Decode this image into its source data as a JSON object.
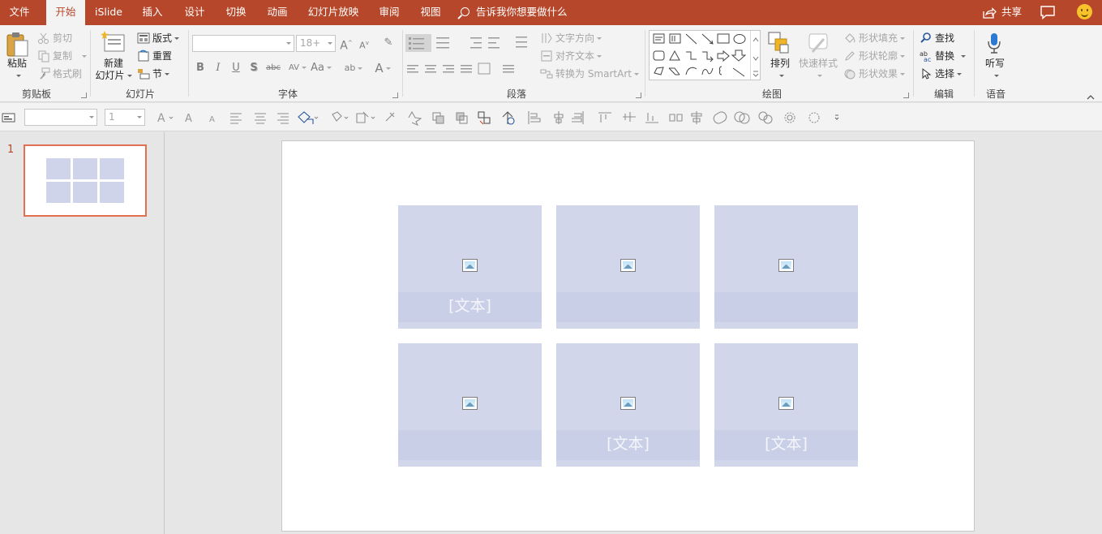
{
  "tabs": [
    {
      "label": "文件",
      "active": false
    },
    {
      "label": "开始",
      "active": true
    },
    {
      "label": "iSlide",
      "active": false
    },
    {
      "label": "插入",
      "active": false
    },
    {
      "label": "设计",
      "active": false
    },
    {
      "label": "切换",
      "active": false
    },
    {
      "label": "动画",
      "active": false
    },
    {
      "label": "幻灯片放映",
      "active": false
    },
    {
      "label": "审阅",
      "active": false
    },
    {
      "label": "视图",
      "active": false
    }
  ],
  "tell_me": "告诉我你想要做什么",
  "share_label": "共享",
  "colors": {
    "accent": "#b7472a",
    "ribbon_bg": "#f3f3f3",
    "placeholder": "#d1d6ea"
  },
  "clipboard": {
    "paste": "粘贴",
    "cut": "剪切",
    "copy": "复制",
    "format_painter": "格式刷",
    "group": "剪贴板"
  },
  "slides_group": {
    "new_slide_line1": "新建",
    "new_slide_line2": "幻灯片",
    "layout": "版式",
    "reset": "重置",
    "section": "节",
    "group": "幻灯片"
  },
  "font_group": {
    "font_name": "",
    "font_size": "18+",
    "bold": "B",
    "italic": "I",
    "underline": "U",
    "shadow": "S",
    "strike": "abc",
    "spacing": "AV",
    "case": "Aa",
    "group": "字体"
  },
  "paragraph": {
    "text_direction": "文字方向",
    "align_text": "对齐文本",
    "smartart": "转换为 SmartArt",
    "group": "段落"
  },
  "drawing": {
    "arrange": "排列",
    "quick_styles": "快速样式",
    "shape_fill": "形状填充",
    "shape_outline": "形状轮廓",
    "shape_effects": "形状效果",
    "group": "绘图"
  },
  "editing": {
    "find": "查找",
    "replace": "替换",
    "select": "选择",
    "group": "编辑"
  },
  "voice": {
    "dictate": "听写",
    "group": "语音"
  },
  "qbar": {
    "size_value": "1"
  },
  "thumbnail": {
    "number": "1"
  },
  "slide": {
    "placeholders": [
      {
        "text": "[文本]"
      },
      {
        "text": ""
      },
      {
        "text": ""
      },
      {
        "text": ""
      },
      {
        "text": "[文本]"
      },
      {
        "text": "[文本]"
      }
    ]
  }
}
